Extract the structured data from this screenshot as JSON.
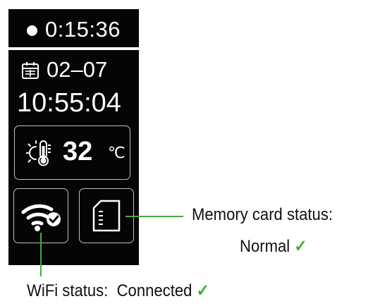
{
  "device": {
    "recording_time": "0:15:36",
    "date": "02–07",
    "clock": "10:55:04",
    "temperature": "32",
    "temperature_unit": "℃",
    "icons": {
      "recording": "record-dot-icon",
      "calendar": "calendar-icon",
      "temperature": "thermometer-sun-icon",
      "wifi": "wifi-connected-icon",
      "memory_card": "sd-card-icon"
    }
  },
  "callouts": {
    "memory_card_label": "Memory card status:",
    "memory_card_value": "Normal",
    "wifi_label": "WiFi status:",
    "wifi_value": "Connected",
    "check_mark": "✓"
  },
  "colors": {
    "device_background": "#050505",
    "callout_green": "#4aa745",
    "check_green": "#3fae3a"
  }
}
